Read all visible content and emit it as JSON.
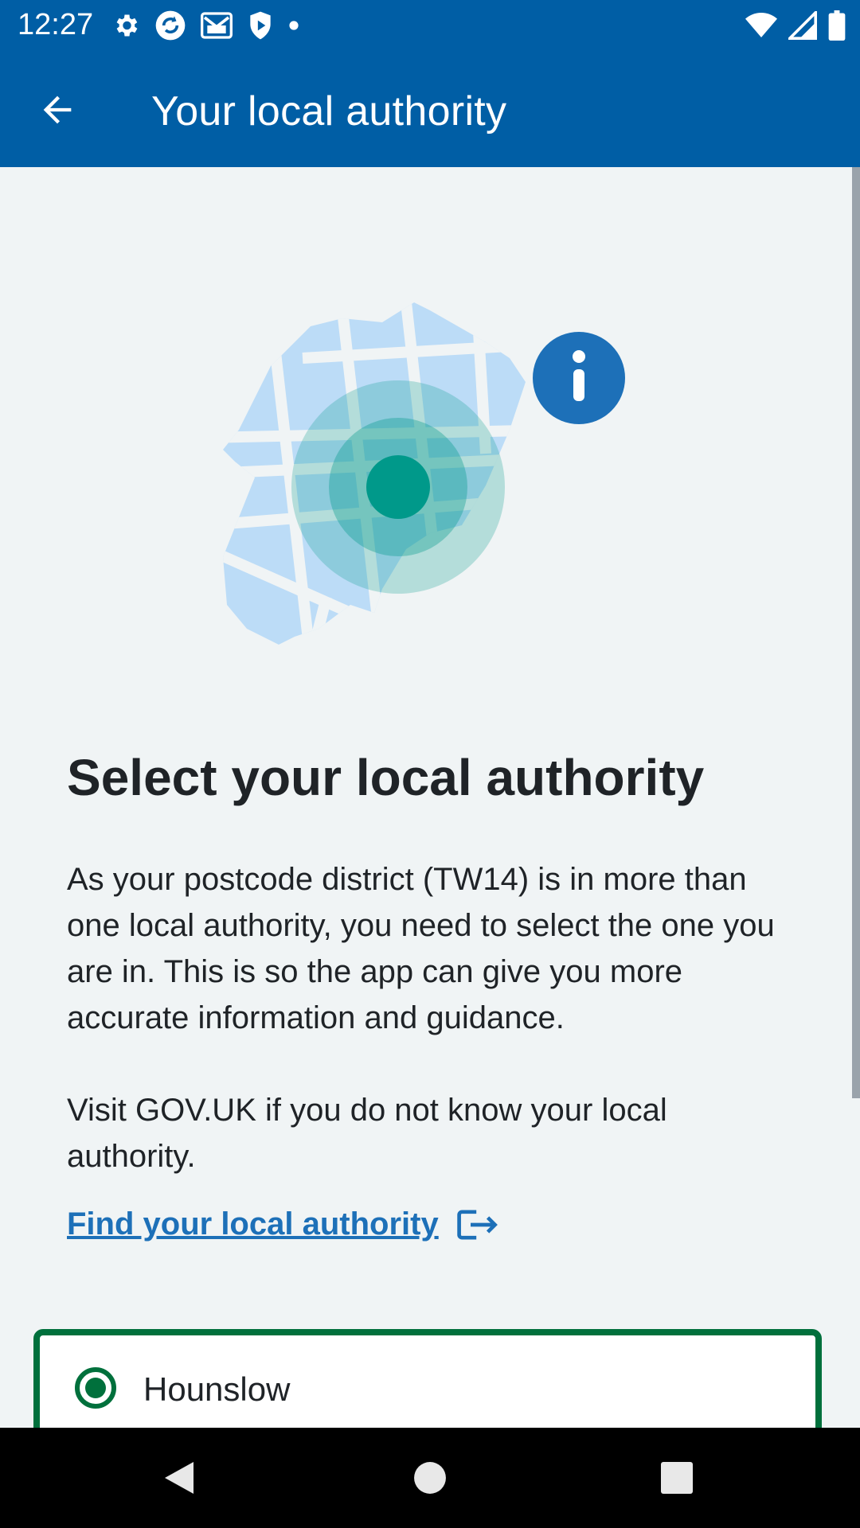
{
  "status_bar": {
    "time": "12:27",
    "left_icons": [
      "gear-icon",
      "sync-icon",
      "gmail-icon",
      "shield-icon",
      "dot-icon"
    ],
    "right_icons": [
      "wifi-icon",
      "signal-icon",
      "battery-icon"
    ]
  },
  "app_bar": {
    "title": "Your local authority",
    "back_icon": "arrow-left-icon"
  },
  "main": {
    "heading": "Select your local authority",
    "paragraph_1": "As your postcode district (TW14) is in more than one local authority, you need to select the one you are in. This is so the app can give you more accurate information and guidance.",
    "paragraph_2": "Visit GOV.UK if you do not know your local authority.",
    "link_label": "Find your local authority",
    "link_icon": "external-link-icon",
    "options": [
      {
        "label": "Hounslow",
        "selected": true
      }
    ]
  },
  "nav_bar": {
    "buttons": [
      "back-triangle-icon",
      "home-circle-icon",
      "recents-square-icon"
    ]
  },
  "colors": {
    "primary": "#005ea5",
    "link": "#1d70b8",
    "selected": "#00703c",
    "background": "#f0f4f5",
    "map_light": "#bcdcf7",
    "map_teal": "#00998a"
  }
}
